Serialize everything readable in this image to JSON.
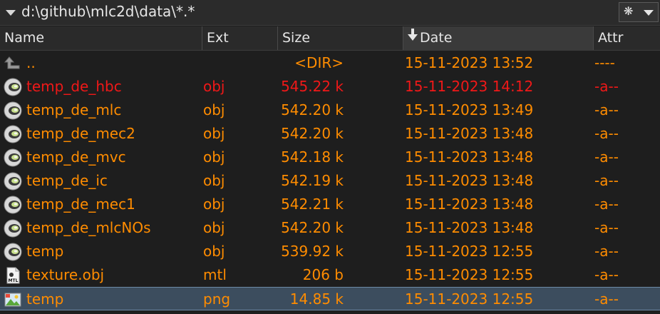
{
  "path": {
    "text": "d:\\github\\mlc2d\\data\\*.*",
    "filter_button": "❋"
  },
  "columns": {
    "name": "Name",
    "ext": "Ext",
    "size": "Size",
    "date": "Date",
    "attr": "Attr"
  },
  "rows": [
    {
      "icon": "up-arrow-icon",
      "name": "..",
      "ext": "",
      "size": "<DIR>",
      "date": "15-11-2023 13:52",
      "attr": "----",
      "style": "normal"
    },
    {
      "icon": "obj-file-icon",
      "name": "temp_de_hbc",
      "ext": "obj",
      "size": "545.22 k",
      "date": "15-11-2023 14:12",
      "attr": "-a--",
      "style": "red"
    },
    {
      "icon": "obj-file-icon",
      "name": "temp_de_mlc",
      "ext": "obj",
      "size": "542.20 k",
      "date": "15-11-2023 13:49",
      "attr": "-a--",
      "style": "normal"
    },
    {
      "icon": "obj-file-icon",
      "name": "temp_de_mec2",
      "ext": "obj",
      "size": "542.20 k",
      "date": "15-11-2023 13:48",
      "attr": "-a--",
      "style": "normal"
    },
    {
      "icon": "obj-file-icon",
      "name": "temp_de_mvc",
      "ext": "obj",
      "size": "542.18 k",
      "date": "15-11-2023 13:48",
      "attr": "-a--",
      "style": "normal"
    },
    {
      "icon": "obj-file-icon",
      "name": "temp_de_ic",
      "ext": "obj",
      "size": "542.19 k",
      "date": "15-11-2023 13:48",
      "attr": "-a--",
      "style": "normal"
    },
    {
      "icon": "obj-file-icon",
      "name": "temp_de_mec1",
      "ext": "obj",
      "size": "542.21 k",
      "date": "15-11-2023 13:48",
      "attr": "-a--",
      "style": "normal"
    },
    {
      "icon": "obj-file-icon",
      "name": "temp_de_mlcNOs",
      "ext": "obj",
      "size": "542.20 k",
      "date": "15-11-2023 13:48",
      "attr": "-a--",
      "style": "normal"
    },
    {
      "icon": "obj-file-icon",
      "name": "temp",
      "ext": "obj",
      "size": "539.92 k",
      "date": "15-11-2023 12:55",
      "attr": "-a--",
      "style": "normal"
    },
    {
      "icon": "mtl-file-icon",
      "icon_label": "MTL",
      "name": "texture.obj",
      "ext": "mtl",
      "size": "206 b",
      "date": "15-11-2023 12:55",
      "attr": "-a--",
      "style": "normal"
    },
    {
      "icon": "png-image-icon",
      "name": "temp",
      "ext": "png",
      "size": "14.85 k",
      "date": "15-11-2023 12:55",
      "attr": "-a--",
      "style": "selected"
    }
  ],
  "colors": {
    "normal_text": "#ff8c00",
    "highlight_text": "#f01818",
    "background": "#1e1e1e",
    "selection": "#3c4d5e"
  }
}
